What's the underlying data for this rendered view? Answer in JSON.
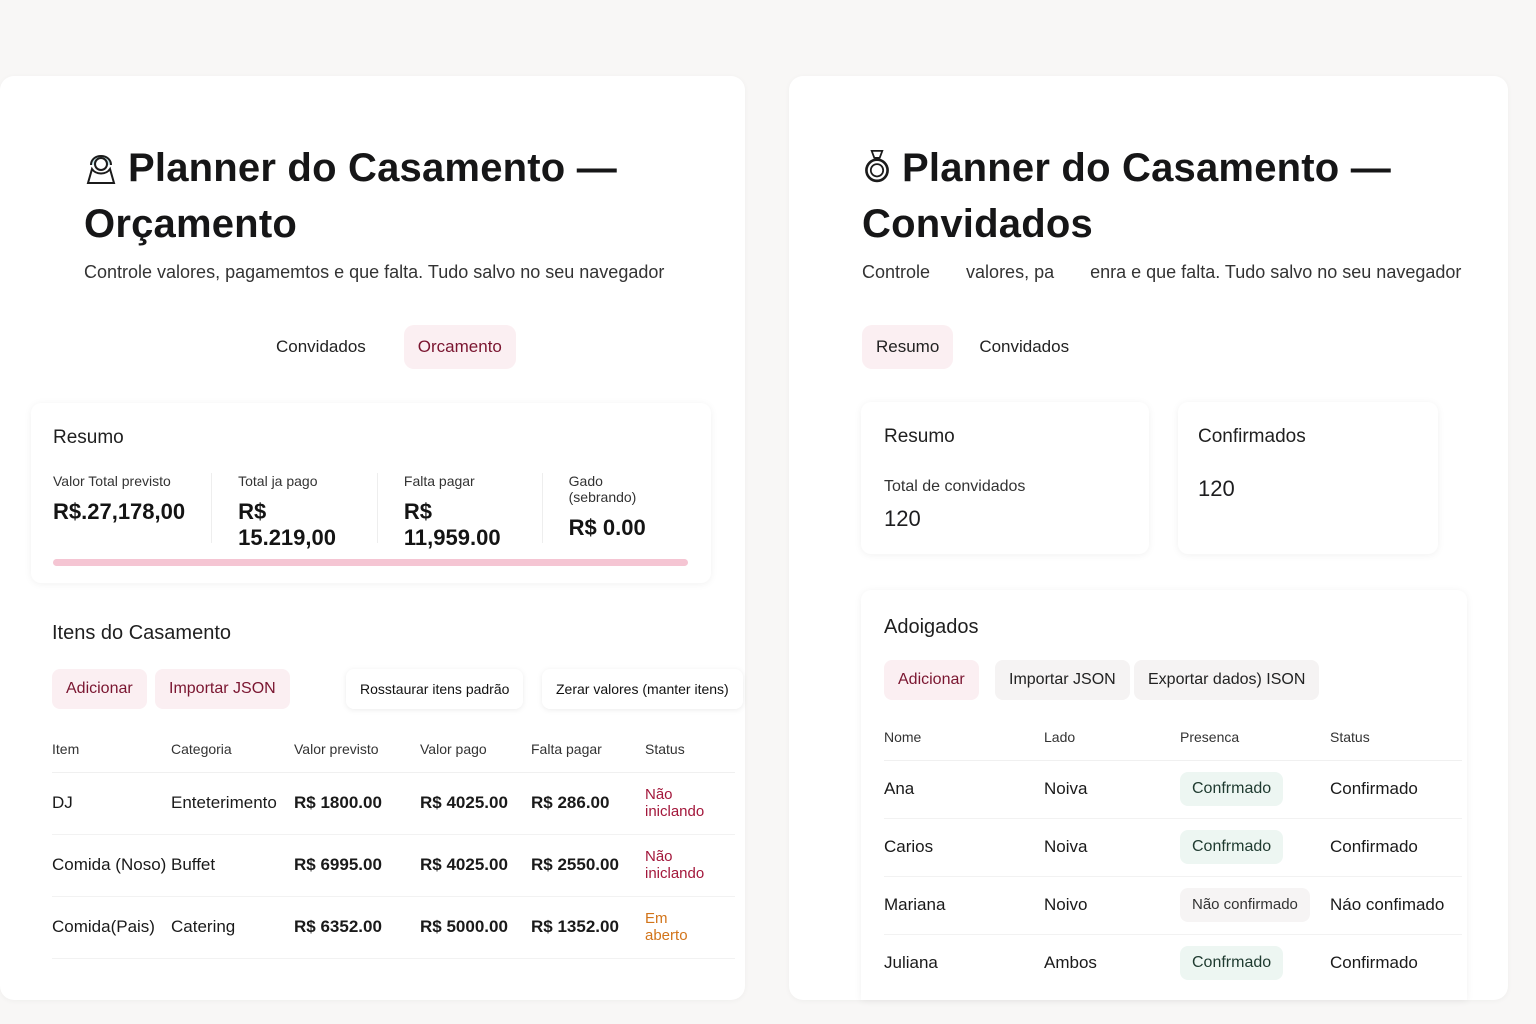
{
  "left": {
    "title": "Planner do Casamento —",
    "title_line2": "Orçamento",
    "subtitle": "Controle valores, pagamemtos e que falta. Tudo salvo no seu navegador",
    "tabs": [
      {
        "label": "Convidados",
        "active": false
      },
      {
        "label": "Orcamento",
        "active": true
      }
    ],
    "summary": {
      "title": "Resumo",
      "stats": [
        {
          "label": "Valor Total previsto",
          "value": "R$.27,178,00"
        },
        {
          "label": "Total ja pago",
          "value": "R$ 15.219,00"
        },
        {
          "label": "Falta pagar",
          "value": "R$ 11,959.00"
        },
        {
          "label": "Gado (sebrando)",
          "value": "R$ 0.00"
        }
      ],
      "progress_fraction": 1.0
    },
    "items": {
      "title": "Itens do Casamento",
      "buttons": {
        "add": "Adicionar",
        "import": "Importar JSON",
        "restore": "Rosstaurar itens padrão",
        "reset": "Zerar valores (manter itens)"
      },
      "columns": [
        "Item",
        "Categoria",
        "Valor previsto",
        "Valor pago",
        "Falta pagar",
        "Status"
      ],
      "rows": [
        {
          "item": "DJ",
          "category": "Enteterimento",
          "planned": "R$ 1800.00",
          "paid": "R$ 4025.00",
          "remaining": "R$ 286.00",
          "status_1": "Não",
          "status_2": "iniclando",
          "status_color": "red"
        },
        {
          "item": "Comida (Noso)",
          "category": "Buffet",
          "planned": "R$ 6995.00",
          "paid": "R$ 4025.00",
          "remaining": "R$ 2550.00",
          "status_1": "Não",
          "status_2": "iniclando",
          "status_color": "red"
        },
        {
          "item": "Comida(Pais)",
          "category": "Catering",
          "planned": "R$ 6352.00",
          "paid": "R$ 5000.00",
          "remaining": "R$ 1352.00",
          "status_1": "Em",
          "status_2": "aberto",
          "status_color": "orange"
        }
      ]
    }
  },
  "right": {
    "title": "Planner do Casamento —",
    "title_line2": "Convidados",
    "subtitle_parts": [
      "Controle",
      "valores, pa",
      "enra e que falta. Tudo salvo no seu navegador"
    ],
    "tabs": [
      {
        "label": "Resumo",
        "active": true
      },
      {
        "label": "Convidados",
        "active": false
      }
    ],
    "summary": {
      "title": "Resumo",
      "label": "Total de convidados",
      "value": "120"
    },
    "confirmed": {
      "title": "Confirmados",
      "value": "120"
    },
    "guests": {
      "title": "Adoigados",
      "buttons": {
        "add": "Adicionar",
        "import": "Importar JSON",
        "export": "Exportar dados) ISON"
      },
      "columns": [
        "Nome",
        "Lado",
        "Presenca",
        "Status"
      ],
      "rows": [
        {
          "name": "Ana",
          "side": "Noiva",
          "presence": "Confrmado",
          "presence_style": "green",
          "status": "Confirmado"
        },
        {
          "name": "Carios",
          "side": "Noiva",
          "presence": "Confrmado",
          "presence_style": "green",
          "status": "Confirmado"
        },
        {
          "name": "Mariana",
          "side": "Noivo",
          "presence": "Não confirmado",
          "presence_style": "grey",
          "status": "Náo confimado"
        },
        {
          "name": "Juliana",
          "side": "Ambos",
          "presence": "Confrmado",
          "presence_style": "green",
          "status": "Confirmado"
        }
      ]
    }
  }
}
